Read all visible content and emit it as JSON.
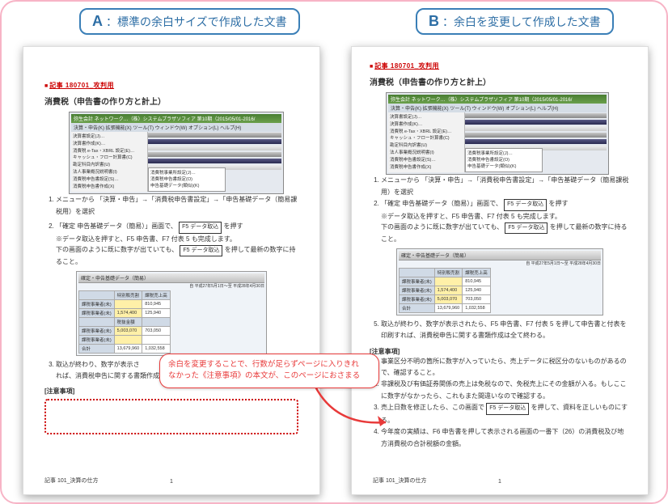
{
  "labels": {
    "a_letter": "A",
    "a_text": "：標準の余白サイズで作成した文書",
    "b_letter": "B",
    "b_text": "：余白を変更して作成した文書"
  },
  "doc_header": {
    "redline": "記事 180701_攻判用",
    "title": "消費税（申告書の作り方と計上）"
  },
  "app": {
    "titlebar_a": "弥生会計 ネットワーク…（株）システムプラザソフィア 第10期（2015/05/01-2016/",
    "titlebar_b": "弥生会計 ネットワーク…（株）システムプラザソフィア 第10期（2015/05/01-2016/",
    "menu": "決算・申告(K)  拡張機能(X)  ツール(T)  ウィンドウ(W)  オプション(L)  ヘルプ(H)",
    "left_items": [
      "決算書設定(J)…",
      "決算書作成(K)…",
      "消費税 e-Tax・XBRL 設定(E)…",
      "キャッシュ・フロー計算書(C)",
      "勘定科目内訳書(U)",
      "法人事業概況説明書(I)",
      "消費税申告書設定(S)…",
      "消費税申告書作成(X)"
    ],
    "submenu_items": [
      "消費税事業所設定(J)…",
      "消費税申告書設定(O)",
      "申告基礎データ(類似)(K)"
    ]
  },
  "body_a": {
    "step1": "メニューから 「決算・申告」→「消費税申告書設定」→「申告基礎データ（簡易課税用）を選択",
    "step2_pre": "「確定 申告基礎データ（簡易）」画面で、",
    "step2_btn": "F5 データ取込",
    "step2_post": " を押す",
    "note1": "※データ取込を押すと、F5 申告書、F7 付表 5 も完成します。",
    "note2_pre": "下の画面のように既に数字が出ていても、",
    "note2_btn": "F5 データ取込",
    "note2_post": " を押して最新の数字に持ること。",
    "step3": "取込が終わり、数字が表示さ",
    "step3b": "れば、消費税申告に関する書類作成は全て終わる。",
    "caution_title": "[注意事項]"
  },
  "table_a": {
    "title": "確定・申告基礎データ（簡易）",
    "period": "自 平成27年5月1日〜至 平成28年4月30日",
    "headers": [
      "",
      "特別販売割",
      "課税売上高"
    ],
    "rows": [
      [
        "課税事業者(未)",
        "",
        "810,945"
      ],
      [
        "課税事業者(未)",
        "1,574,400",
        "125,940"
      ],
      [
        "",
        "税抜金額",
        ""
      ],
      [
        "課税事業者(未)",
        "5,003,070",
        "703,050"
      ],
      [
        "課税事業者(未)",
        "",
        ""
      ],
      [
        "合計",
        "13,679,960",
        "1,032,558"
      ]
    ]
  },
  "body_b": {
    "step1": "メニューから 「決算・申告」→「消費税申告書設定」→「申告基礎データ（簡易課税用）を選択",
    "step2_pre": "「確定 申告基礎データ（簡易）」画面で、",
    "step2_btn": "F5 データ取込",
    "step2_post": " を押す",
    "note1": "※データ取込を押すと、F5 申告書、F7 付表 5 も完成します。",
    "note2_pre": "下の画面のように既に数字が出ていても、",
    "note2_btn": "F5 データ取込",
    "note2_post": " を押して最新の数字に持ること。",
    "step5": "取込が終わり、数字が表示されたら、F5 申告書、F7 付表 5 を押して申告書と付表を印刷すれば、消費税申告に関する書類作成は全て終わる。",
    "caution_title": "[注意事項]",
    "c1": "事業区分不明の箇所に数字が入っていたら、売上データに税区分のないものがあるので、確認すること。",
    "c2_pre": "非課税及び有価証券関係の売上は免税なので、免税売上にその金額が入る。もしここに数字がなかったら、これもまた間違いなので確認する。",
    "c3_pre": "売上日数を修正したら、この画面で ",
    "c3_btn": "F5 データ取込",
    "c3_post": " を押して、資料を正しいものにする。",
    "c4": "今年度の実績は、F6 申告書を押して表示される画面の一番下（26）の消費税及び地方消費税の合計税額の金額。"
  },
  "footer": {
    "left": "記事 101_決算の仕方",
    "center": "1"
  },
  "callout": {
    "line1": "余白を変更することで、行数が足らずページに入りきれ",
    "line2": "なかった《注意事項》の本文が、このページにおさまる"
  }
}
